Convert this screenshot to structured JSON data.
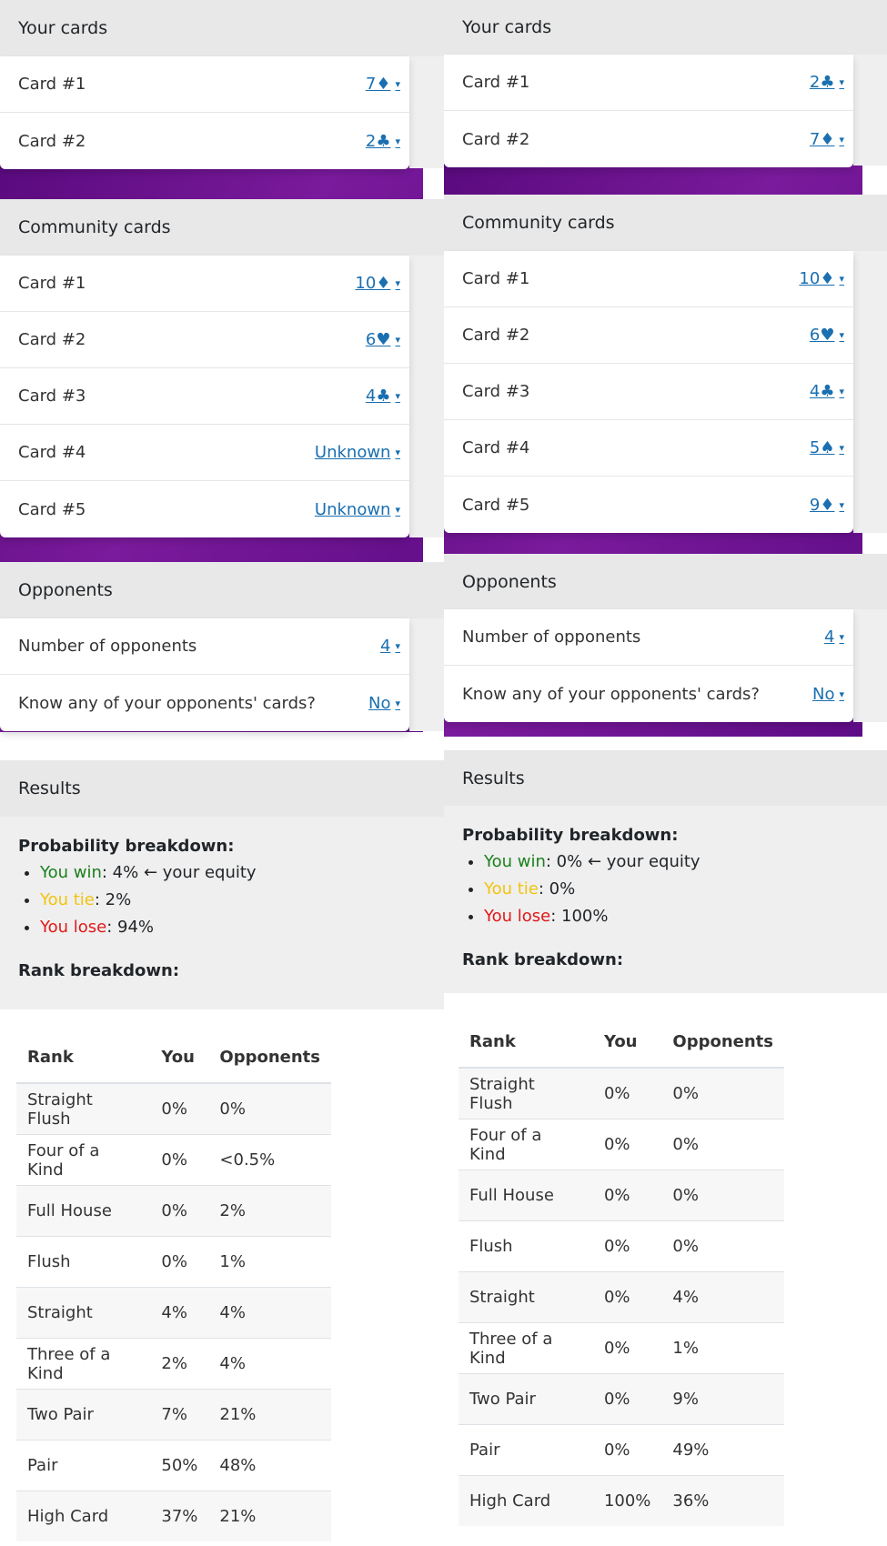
{
  "left": {
    "your_cards": {
      "title": "Your cards",
      "cards": [
        {
          "label": "Card #1",
          "value": "7♦"
        },
        {
          "label": "Card #2",
          "value": "2♣"
        }
      ]
    },
    "community": {
      "title": "Community cards",
      "cards": [
        {
          "label": "Card #1",
          "value": "10♦"
        },
        {
          "label": "Card #2",
          "value": "6♥"
        },
        {
          "label": "Card #3",
          "value": "4♣"
        },
        {
          "label": "Card #4",
          "value": "Unknown"
        },
        {
          "label": "Card #5",
          "value": "Unknown"
        }
      ]
    },
    "opponents": {
      "title": "Opponents",
      "rows": [
        {
          "label": "Number of opponents",
          "value": "4"
        },
        {
          "label": "Know any of your opponents' cards?",
          "value": "No"
        }
      ]
    },
    "results": {
      "title": "Results",
      "prob_label": "Probability breakdown:",
      "win_label": "You win",
      "win_value": ": 4% ← your equity",
      "tie_label": "You tie",
      "tie_value": ": 2%",
      "lose_label": "You lose",
      "lose_value": ": 94%",
      "rank_label": "Rank breakdown:"
    },
    "rank_table": {
      "headers": [
        "Rank",
        "You",
        "Opponents"
      ],
      "rows": [
        [
          "Straight Flush",
          "0%",
          "0%"
        ],
        [
          "Four of a Kind",
          "0%",
          "<0.5%"
        ],
        [
          "Full House",
          "0%",
          "2%"
        ],
        [
          "Flush",
          "0%",
          "1%"
        ],
        [
          "Straight",
          "4%",
          "4%"
        ],
        [
          "Three of a Kind",
          "2%",
          "4%"
        ],
        [
          "Two Pair",
          "7%",
          "21%"
        ],
        [
          "Pair",
          "50%",
          "48%"
        ],
        [
          "High Card",
          "37%",
          "21%"
        ]
      ]
    }
  },
  "right": {
    "your_cards": {
      "title": "Your cards",
      "cards": [
        {
          "label": "Card #1",
          "value": "2♣"
        },
        {
          "label": "Card #2",
          "value": "7♦"
        }
      ]
    },
    "community": {
      "title": "Community cards",
      "cards": [
        {
          "label": "Card #1",
          "value": "10♦"
        },
        {
          "label": "Card #2",
          "value": "6♥"
        },
        {
          "label": "Card #3",
          "value": "4♣"
        },
        {
          "label": "Card #4",
          "value": "5♠"
        },
        {
          "label": "Card #5",
          "value": "9♦"
        }
      ]
    },
    "opponents": {
      "title": "Opponents",
      "rows": [
        {
          "label": "Number of opponents",
          "value": "4"
        },
        {
          "label": "Know any of your opponents' cards?",
          "value": "No"
        }
      ]
    },
    "results": {
      "title": "Results",
      "prob_label": "Probability breakdown:",
      "win_label": "You win",
      "win_value": ": 0% ← your equity",
      "tie_label": "You tie",
      "tie_value": ": 0%",
      "lose_label": "You lose",
      "lose_value": ": 100%",
      "rank_label": "Rank breakdown:"
    },
    "rank_table": {
      "headers": [
        "Rank",
        "You",
        "Opponents"
      ],
      "rows": [
        [
          "Straight Flush",
          "0%",
          "0%"
        ],
        [
          "Four of a Kind",
          "0%",
          "0%"
        ],
        [
          "Full House",
          "0%",
          "0%"
        ],
        [
          "Flush",
          "0%",
          "0%"
        ],
        [
          "Straight",
          "0%",
          "4%"
        ],
        [
          "Three of a Kind",
          "0%",
          "1%"
        ],
        [
          "Two Pair",
          "0%",
          "9%"
        ],
        [
          "Pair",
          "0%",
          "49%"
        ],
        [
          "High Card",
          "100%",
          "36%"
        ]
      ]
    }
  },
  "dropdown_caret": "▾",
  "colors": {
    "link": "#1a6fb0",
    "win": "#1a7f1a",
    "tie": "#f1c40f",
    "lose": "#e01919",
    "band": "#6a1290"
  }
}
